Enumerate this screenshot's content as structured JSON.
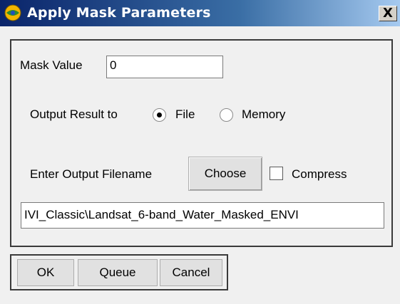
{
  "window": {
    "title": "Apply Mask Parameters",
    "close_label": "X",
    "app_icon": "envi-globe-icon"
  },
  "mask": {
    "label": "Mask Value",
    "value": "0"
  },
  "output": {
    "label": "Output Result to",
    "options": [
      {
        "label": "File",
        "selected": true
      },
      {
        "label": "Memory",
        "selected": false
      }
    ]
  },
  "filename": {
    "label": "Enter Output Filename",
    "choose_label": "Choose",
    "compress_label": "Compress",
    "compress_checked": false,
    "value": "IVI_Classic\\Landsat_6-band_Water_Masked_ENVI"
  },
  "buttons": {
    "ok": "OK",
    "queue": "Queue",
    "cancel": "Cancel"
  }
}
